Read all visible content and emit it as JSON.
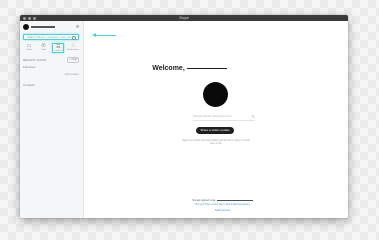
{
  "window": {
    "title": "Skype"
  },
  "sidebar": {
    "search_placeholder": "Search Skype, contacts, and more",
    "nav": [
      {
        "label": "Chats",
        "icon": "chat-icon"
      },
      {
        "label": "Calls",
        "icon": "phone-icon"
      },
      {
        "label": "Contacts",
        "icon": "contacts-icon"
      },
      {
        "label": "Notifications",
        "icon": "bell-icon"
      }
    ],
    "recent_label": "RECENT CHATS",
    "new_chat_label": "+ Chat",
    "favorites_label": "Favorites",
    "favorites_action": "Add favorites",
    "contacts_label": "Contacts"
  },
  "main": {
    "welcome": "Welcome,",
    "mood_placeholder": "Tell your friends what you're up to",
    "share_button": "Share a status update",
    "share_caption": "Share your profile and start chatting with friends on Skype or invite them to join",
    "signed_in_prefix": "You are signed in as",
    "not_you": "Not you? Sign out and sign in with a different account",
    "sign_out_link": "Switch account"
  }
}
